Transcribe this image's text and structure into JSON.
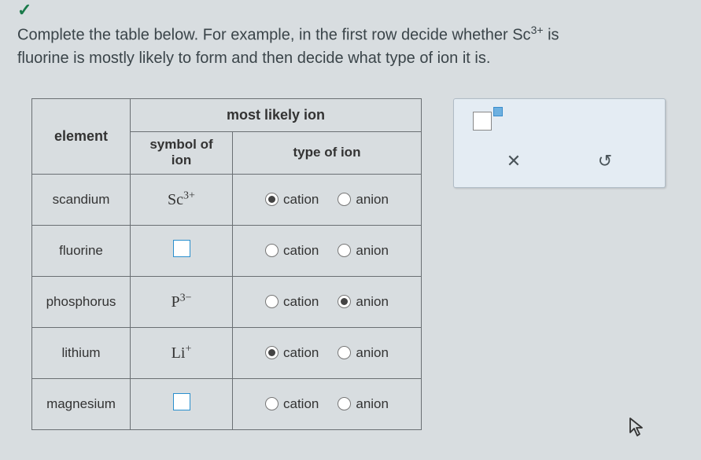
{
  "icons": {
    "check": "✓",
    "close": "✕",
    "undo": "↺",
    "cursor": "⇱"
  },
  "instructions": {
    "line1_pre": "Complete the table below. For example, in the first row decide whether Sc",
    "line1_sup": "3+",
    "line1_post": " is",
    "line2": "fluorine is mostly likely to form and then decide what type of ion it is."
  },
  "headers": {
    "element": "element",
    "most_likely_ion": "most likely ion",
    "symbol_of_ion_1": "symbol of",
    "symbol_of_ion_2": "ion",
    "type_of_ion": "type of ion"
  },
  "labels": {
    "cation": "cation",
    "anion": "anion"
  },
  "rows": [
    {
      "element": "scandium",
      "ion_base": "Sc",
      "ion_sup": "3+",
      "blank": false,
      "cation": true,
      "anion": false
    },
    {
      "element": "fluorine",
      "ion_base": "",
      "ion_sup": "",
      "blank": true,
      "cation": false,
      "anion": false
    },
    {
      "element": "phosphorus",
      "ion_base": "P",
      "ion_sup": "3−",
      "blank": false,
      "cation": false,
      "anion": true
    },
    {
      "element": "lithium",
      "ion_base": "Li",
      "ion_sup": "+",
      "blank": false,
      "cation": true,
      "anion": false
    },
    {
      "element": "magnesium",
      "ion_base": "",
      "ion_sup": "",
      "blank": true,
      "cation": false,
      "anion": false
    }
  ]
}
